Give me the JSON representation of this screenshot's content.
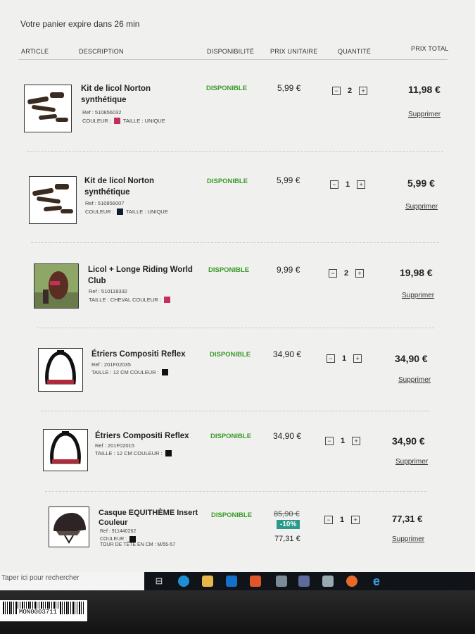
{
  "timer": "Votre panier expire dans 26 min",
  "headers": {
    "article": "ARTICLE",
    "description": "DESCRIPTION",
    "availability": "DISPONIBILITÉ",
    "unit_price": "PRIX UNITAIRE",
    "quantity": "QUANTITÉ",
    "total": "PRIX TOTAL"
  },
  "items": [
    {
      "name": "Kit de licol Norton synthétique",
      "ref": "Ref : 510856032",
      "attrs": "COULEUR :",
      "attrs2": "TAILLE : UNIQUE",
      "swatch": "#c4305a",
      "availability": "DISPONIBLE",
      "unit_price": "5,99 €",
      "qty": "2",
      "total": "11,98 €",
      "delete": "Supprimer",
      "thumb": "halter-brown"
    },
    {
      "name": "Kit de licol Norton synthétique",
      "ref": "Ref : 510856007",
      "attrs": "COULEUR :",
      "attrs2": "TAILLE : UNIQUE",
      "swatch": "#141a2e",
      "availability": "DISPONIBLE",
      "unit_price": "5,99 €",
      "qty": "1",
      "total": "5,99 €",
      "delete": "Supprimer",
      "thumb": "halter-brown"
    },
    {
      "name": "Licol + Longe Riding World Club",
      "ref": "Ref : 510118332",
      "attrs": "TAILLE : CHEVAL COULEUR :",
      "attrs2": "",
      "swatch": "#c4305a",
      "availability": "DISPONIBLE",
      "unit_price": "9,99 €",
      "qty": "2",
      "total": "19,98 €",
      "delete": "Supprimer",
      "thumb": "horse-photo"
    },
    {
      "name": "Étriers Compositi Reflex",
      "ref": "Ref : 201F02035",
      "attrs": "TAILLE : 12 CM COULEUR :",
      "attrs2": "",
      "swatch": "#111111",
      "availability": "DISPONIBLE",
      "unit_price": "34,90 €",
      "qty": "1",
      "total": "34,90 €",
      "delete": "Supprimer",
      "thumb": "stirrup"
    },
    {
      "name": "Étriers Compositi Reflex",
      "ref": "Ref : 201F02015",
      "attrs": "TAILLE : 12 CM COULEUR :",
      "attrs2": "",
      "swatch": "#111111",
      "availability": "DISPONIBLE",
      "unit_price": "34,90 €",
      "qty": "1",
      "total": "34,90 €",
      "delete": "Supprimer",
      "thumb": "stirrup"
    },
    {
      "name": "Casque EQUITHÈME Insert Couleur",
      "ref": "Ref : 911440262",
      "attrs": "COULEUR :",
      "attrs2": "TOUR DE TÊTE EN CM : M/55-57",
      "swatch": "#111111",
      "availability": "DISPONIBLE",
      "unit_price": "77,31 €",
      "old_price": "85,90 €",
      "discount": "-10%",
      "qty": "1",
      "total": "77,31 €",
      "delete": "Supprimer",
      "thumb": "helmet"
    }
  ],
  "taskbar": {
    "search_placeholder": "Taper ici pour rechercher"
  },
  "sticker": "MON0003711",
  "colors": {
    "available_green": "#3b9a2b",
    "discount_badge": "#2a9a8a"
  }
}
